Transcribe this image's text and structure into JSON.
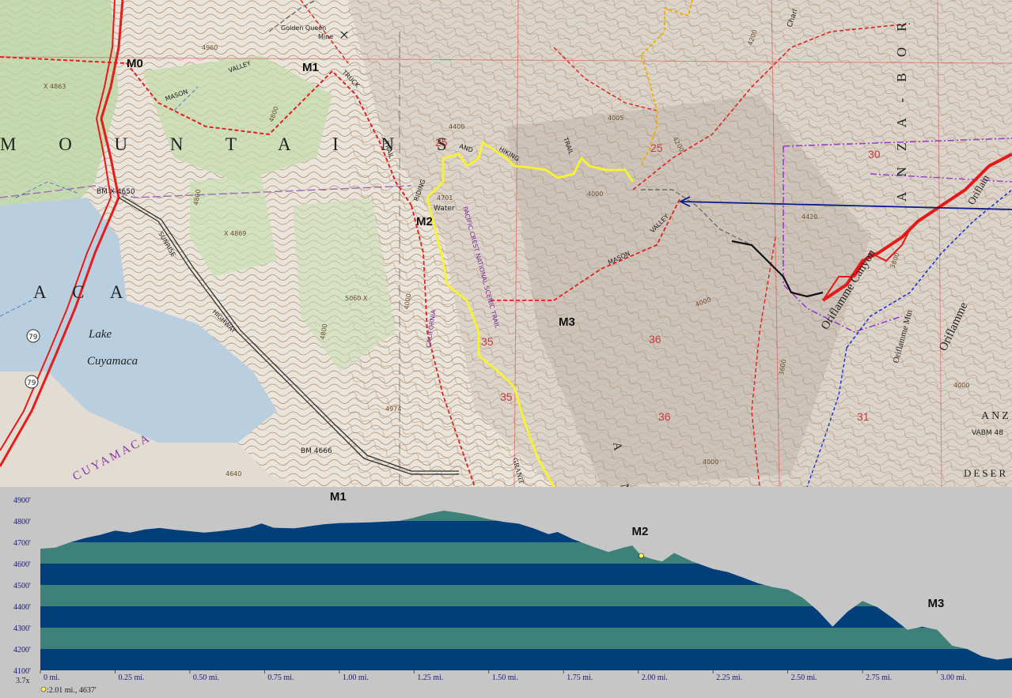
{
  "map": {
    "markers": [
      {
        "id": "M0",
        "label": "M0"
      },
      {
        "id": "M1",
        "label": "M1"
      },
      {
        "id": "M2",
        "label": "M2"
      },
      {
        "id": "M3",
        "label": "M3"
      }
    ],
    "labels": {
      "mountains": "M O U N T A I N S",
      "aca": "A    C    A",
      "lake1": "Lake",
      "lake2": "Cuyamaca",
      "cuyamaca": "CUYAMACA",
      "golden_queen": "Golden Queen",
      "mine": "Mine",
      "bm4650": "BM X 4650",
      "bm4666": "BM 4666",
      "mason_valley_1": "MASON",
      "mason_valley_2": "VALLEY",
      "mason2": "MASON",
      "valley2": "VALLEY",
      "truck": "TRUCK",
      "trail": "TRAIL",
      "riding": "RIDING",
      "and": "AND",
      "hiking": "HIKING",
      "trail2": "TRAIL",
      "water": "Water",
      "pct": "PACIFIC CREST NATIONAL SCENIC TRAIL",
      "california": "CALIFORNIA",
      "sunrise": "SUNRISE",
      "highway": "HIGHWAY",
      "oriflamme_canyon": "Oriflamme Canyon",
      "oriflamme_mtn": "Oriflamme Mtn",
      "oriflamme": "Oriflamme",
      "oriflamme2": "Oriflam",
      "anza": "A N Z A - B O R",
      "anza2": "ANZ",
      "desert": "DESER",
      "vabm": "VABM 48",
      "charl": "Charl",
      "section_25a": "25",
      "section_25b": "25",
      "section_30": "30",
      "section_36a": "36",
      "section_36b": "36",
      "section_35a": "35",
      "section_35b": "35",
      "section_31": "31",
      "hwy79a": "79",
      "hwy79b": "79",
      "granite": "GRANIT",
      "an": "A N",
      "elev_4960": "4960",
      "elev_4863": "X 4863",
      "elev_4800": "4800",
      "elev_4869": "X 4869",
      "elev_4400": "4400",
      "elev_4701": "4701",
      "elev_4005": "4005",
      "elev_4200": "4200",
      "elev_4000a": "4000",
      "elev_4000b": "4000",
      "elev_4000c": "4000",
      "elev_5060": "5060 X",
      "elev_4974": "4974",
      "elev_4640": "4640",
      "elev_4800b": "4800",
      "elev_4800c": "4800",
      "elev_3600": "3600",
      "elev_3800": "3800",
      "elev_4200b": "4200",
      "elev_4000d": "4000",
      "elev_4420": "4420",
      "elev_4000e": "4000"
    }
  },
  "profile": {
    "zoom": "3.7x",
    "cursor_readout": ":2.01 mi., 4637'",
    "cursor": {
      "distance_mi": 2.01,
      "elevation_ft": 4637
    },
    "y_axis": {
      "min": 4100,
      "max": 4900,
      "ticks": [
        "4100'",
        "4200'",
        "4300'",
        "4400'",
        "4500'",
        "4600'",
        "4700'",
        "4800'",
        "4900'"
      ]
    },
    "x_axis": {
      "min": 0,
      "max": 3.2,
      "ticks": [
        "0 mi.",
        "0.25 mi.",
        "0.50 mi.",
        "0.75 mi.",
        "1.00 mi.",
        "1.25 mi.",
        "1.50 mi.",
        "1.75 mi.",
        "2.00 mi.",
        "2.25 mi.",
        "2.50 mi.",
        "2.75 mi.",
        "3.00 mi."
      ]
    },
    "markers": [
      {
        "label": "M1",
        "distance_mi": 1.0,
        "elevation_ft": 4800
      },
      {
        "label": "M2",
        "distance_mi": 2.01,
        "elevation_ft": 4637
      },
      {
        "label": "M3",
        "distance_mi": 3.0,
        "elevation_ft": 4300
      }
    ],
    "colors": {
      "band_dark": "#003f7a",
      "band_light": "#3e8178",
      "background": "#c6c6c6",
      "cursor": "#ffff55"
    },
    "elevation_points": [
      [
        0,
        4670
      ],
      [
        0.05,
        4675
      ],
      [
        0.1,
        4700
      ],
      [
        0.15,
        4720
      ],
      [
        0.2,
        4735
      ],
      [
        0.25,
        4755
      ],
      [
        0.3,
        4745
      ],
      [
        0.35,
        4760
      ],
      [
        0.4,
        4767
      ],
      [
        0.45,
        4758
      ],
      [
        0.5,
        4752
      ],
      [
        0.55,
        4745
      ],
      [
        0.6,
        4752
      ],
      [
        0.65,
        4760
      ],
      [
        0.7,
        4770
      ],
      [
        0.74,
        4788
      ],
      [
        0.78,
        4768
      ],
      [
        0.85,
        4765
      ],
      [
        0.9,
        4775
      ],
      [
        0.95,
        4785
      ],
      [
        1.0,
        4790
      ],
      [
        1.1,
        4793
      ],
      [
        1.2,
        4800
      ],
      [
        1.25,
        4815
      ],
      [
        1.3,
        4835
      ],
      [
        1.35,
        4848
      ],
      [
        1.4,
        4838
      ],
      [
        1.45,
        4825
      ],
      [
        1.5,
        4808
      ],
      [
        1.55,
        4795
      ],
      [
        1.6,
        4787
      ],
      [
        1.65,
        4765
      ],
      [
        1.7,
        4738
      ],
      [
        1.73,
        4748
      ],
      [
        1.78,
        4715
      ],
      [
        1.85,
        4678
      ],
      [
        1.9,
        4655
      ],
      [
        1.95,
        4675
      ],
      [
        1.98,
        4685
      ],
      [
        2.01,
        4637
      ],
      [
        2.05,
        4620
      ],
      [
        2.08,
        4610
      ],
      [
        2.12,
        4650
      ],
      [
        2.18,
        4610
      ],
      [
        2.25,
        4575
      ],
      [
        2.3,
        4560
      ],
      [
        2.35,
        4535
      ],
      [
        2.4,
        4508
      ],
      [
        2.45,
        4490
      ],
      [
        2.5,
        4478
      ],
      [
        2.55,
        4440
      ],
      [
        2.6,
        4380
      ],
      [
        2.65,
        4305
      ],
      [
        2.7,
        4375
      ],
      [
        2.75,
        4425
      ],
      [
        2.8,
        4395
      ],
      [
        2.85,
        4345
      ],
      [
        2.9,
        4290
      ],
      [
        2.95,
        4305
      ],
      [
        3.0,
        4290
      ],
      [
        3.05,
        4215
      ],
      [
        3.1,
        4200
      ],
      [
        3.15,
        4165
      ],
      [
        3.2,
        4150
      ],
      [
        3.25,
        4158
      ]
    ]
  }
}
